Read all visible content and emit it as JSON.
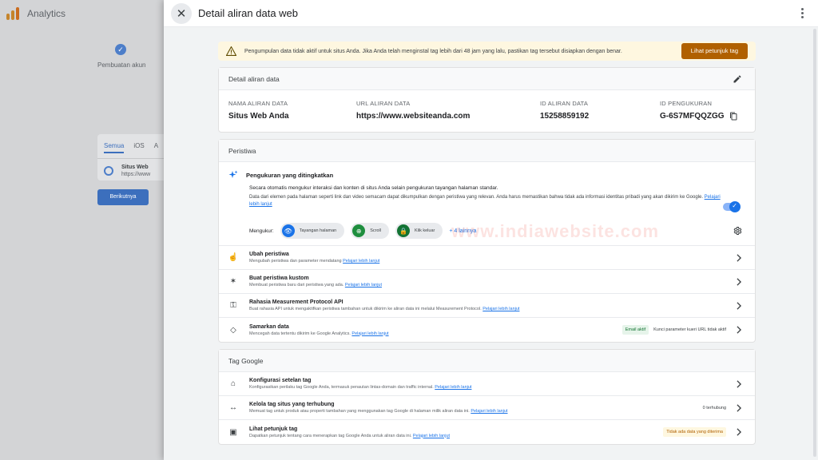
{
  "background": {
    "app_title": "Analytics",
    "step_label": "Pembuatan akun",
    "step_check": "✓",
    "tabs": [
      "Semua",
      "iOS",
      "A"
    ],
    "stream_name": "Situs Web",
    "stream_url": "https://www",
    "next_button": "Berikutnya"
  },
  "header": {
    "title": "Detail aliran data web",
    "close_symbol": "✕"
  },
  "alert": {
    "text": "Pengumpulan data tidak aktif untuk situs Anda. Jika Anda telah menginstal tag lebih dari 48 jam yang lalu, pastikan tag tersebut disiapkan dengan benar.",
    "button": "Lihat petunjuk tag"
  },
  "stream_details": {
    "heading": "Detail aliran data",
    "fields": [
      {
        "label": "NAMA ALIRAN DATA",
        "value": "Situs Web Anda"
      },
      {
        "label": "URL ALIRAN DATA",
        "value": "https://www.websiteanda.com"
      },
      {
        "label": "ID ALIRAN DATA",
        "value": "15258859192"
      },
      {
        "label": "ID PENGUKURAN",
        "value": "G-6S7MFQQZGG"
      }
    ]
  },
  "events": {
    "heading": "Peristiwa",
    "enhanced": {
      "title": "Pengukuran yang ditingkatkan",
      "desc1": "Secara otomatis mengukur interaksi dan konten di situs Anda selain pengukuran tayangan halaman standar.",
      "desc2": "Data dari elemen pada halaman seperti link dan video semacam dapat dikumpulkan dengan peristiwa yang relevan. Anda harus memastikan bahwa tidak ada informasi identitas pribadi yang akan dikirim ke Google.",
      "learn_more": "Pelajari lebih lanjut",
      "toggle_check": "✓",
      "measure_label": "Mengukur:",
      "chips": [
        {
          "label": "Tayangan halaman",
          "color": "#1a73e8",
          "icon": "👁"
        },
        {
          "label": "Scroll",
          "color": "#1e8e3e",
          "icon": "⊕"
        },
        {
          "label": "Klik keluar",
          "color": "#137333",
          "icon": "🔒"
        }
      ],
      "more": "+ 4 lainnya"
    },
    "rows": [
      {
        "title": "Ubah peristiwa",
        "desc": "Mengubah peristiwa dan parameter mendatang",
        "link": "Pelajari lebih lanjut",
        "icon": "☝"
      },
      {
        "title": "Buat peristiwa kustom",
        "desc": "Membuat peristiwa baru dari peristiwa yang ada.",
        "link": "Pelajari lebih lanjut",
        "icon": "✶"
      },
      {
        "title": "Rahasia Measurement Protocol API",
        "desc": "Buat rahasia API untuk mengaktifkan peristiwa tambahan untuk dikirim ke aliran data ini melalui Measurement Protocol.",
        "link": "Pelajari lebih lanjut",
        "icon": "⚿"
      },
      {
        "title": "Samarkan data",
        "desc": "Mencegah data tertentu dikirim ke Google Analytics.",
        "link": "Pelajari lebih lanjut",
        "icon": "◇",
        "badge1": "Email aktif",
        "badge2": "Kunci parameter kueri URL tidak aktif"
      }
    ]
  },
  "google_tag": {
    "heading": "Tag Google",
    "rows": [
      {
        "title": "Konfigurasi setelan tag",
        "desc": "Konfigurasikan perilaku tag Google Anda, termasuk penautan lintas-domain dan traffic internal.",
        "link": "Pelajari lebih lanjut",
        "icon": "⌂"
      },
      {
        "title": "Kelola tag situs yang terhubung",
        "desc": "Memuat tag untuk produk atau properti tambahan yang menggunakan tag Google di halaman milik aliran data ini.",
        "link": "Pelajari lebih lanjut",
        "icon": "↔",
        "right": "0 terhubung"
      },
      {
        "title": "Lihat petunjuk tag",
        "desc": "Dapatkan petunjuk tentang cara menerapkan tag Google Anda untuk aliran data ini.",
        "link": "Pelajari lebih lanjut",
        "icon": "▣",
        "right_badge": "Tidak ada data yang diterima"
      }
    ]
  },
  "watermark": "www.indiawebsite.com"
}
